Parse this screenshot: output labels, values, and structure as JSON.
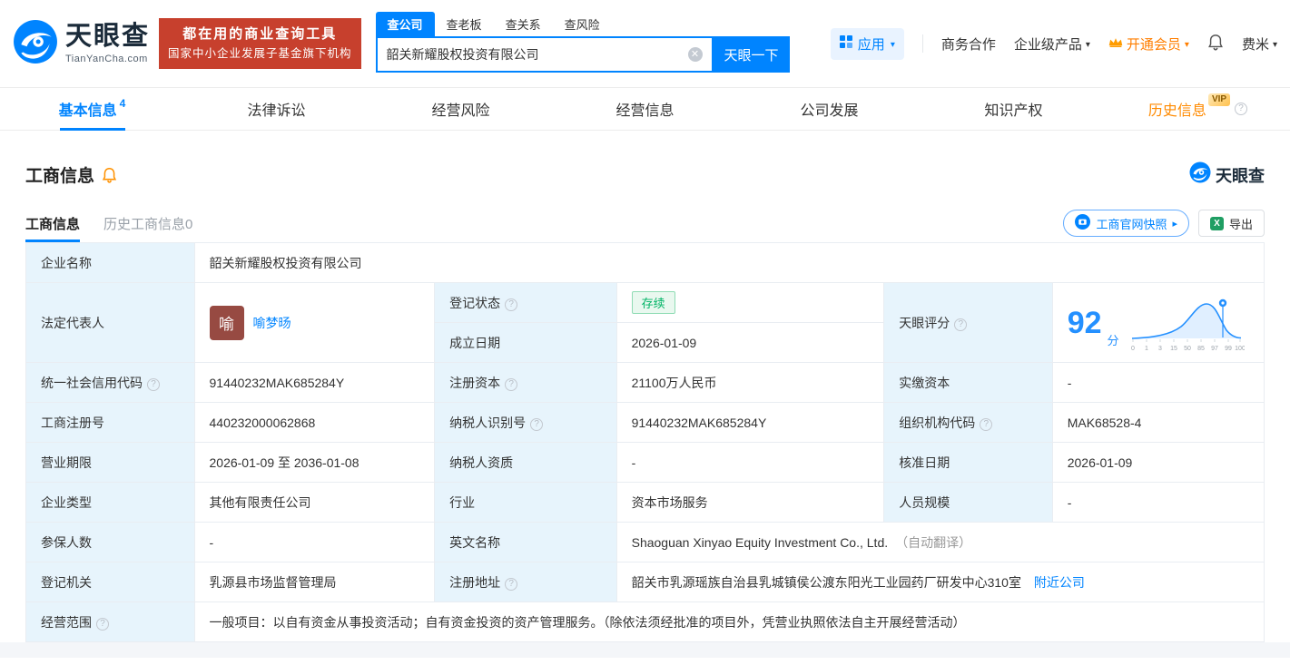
{
  "brand": {
    "name": "天眼查",
    "domain": "TianYanCha.com",
    "slogan_line1": "都在用的商业查询工具",
    "slogan_line2": "国家中小企业发展子基金旗下机构"
  },
  "search": {
    "tabs": [
      {
        "label": "查公司"
      },
      {
        "label": "查老板"
      },
      {
        "label": "查关系"
      },
      {
        "label": "查风险"
      }
    ],
    "value": "韶关新耀股权投资有限公司",
    "button_label": "天眼一下"
  },
  "topnav": {
    "apps": "应用",
    "business_coop": "商务合作",
    "enterprise_products": "企业级产品",
    "vip": "开通会员",
    "username": "费米"
  },
  "tabs": [
    {
      "label": "基本信息",
      "count": "4"
    },
    {
      "label": "法律诉讼"
    },
    {
      "label": "经营风险"
    },
    {
      "label": "经营信息"
    },
    {
      "label": "公司发展"
    },
    {
      "label": "知识产权"
    },
    {
      "label": "历史信息",
      "badge": "VIP"
    }
  ],
  "section": {
    "title": "工商信息",
    "subtabs": [
      {
        "label": "工商信息"
      },
      {
        "label": "历史工商信息0"
      }
    ],
    "snapshot_button": "工商官网快照",
    "export_button": "导出"
  },
  "info": {
    "company_name_label": "企业名称",
    "company_name": "韶关新耀股权投资有限公司",
    "legal_rep_label": "法定代表人",
    "legal_rep_avatar": "喻",
    "legal_rep_name": "喻梦旸",
    "reg_status_label": "登记状态",
    "reg_status": "存续",
    "establish_date_label": "成立日期",
    "establish_date": "2026-01-09",
    "score_label": "天眼评分",
    "credit_code_label": "统一社会信用代码",
    "credit_code": "91440232MAK685284Y",
    "reg_capital_label": "注册资本",
    "reg_capital": "21100万人民币",
    "paid_capital_label": "实缴资本",
    "paid_capital": "-",
    "reg_number_label": "工商注册号",
    "reg_number": "440232000062868",
    "taxpayer_id_label": "纳税人识别号",
    "taxpayer_id": "91440232MAK685284Y",
    "org_code_label": "组织机构代码",
    "org_code": "MAK68528-4",
    "business_term_label": "营业期限",
    "business_term": "2026-01-09 至 2036-01-08",
    "taxpayer_quality_label": "纳税人资质",
    "taxpayer_quality": "-",
    "approval_date_label": "核准日期",
    "approval_date": "2026-01-09",
    "company_type_label": "企业类型",
    "company_type": "其他有限责任公司",
    "industry_label": "行业",
    "industry": "资本市场服务",
    "staff_size_label": "人员规模",
    "staff_size": "-",
    "insured_count_label": "参保人数",
    "insured_count": "-",
    "english_name_label": "英文名称",
    "english_name": "Shaoguan Xinyao Equity Investment Co., Ltd.",
    "english_name_note": "（自动翻译）",
    "reg_authority_label": "登记机关",
    "reg_authority": "乳源县市场监督管理局",
    "address_label": "注册地址",
    "address": "韶关市乳源瑶族自治县乳城镇侯公渡东阳光工业园药厂研发中心310室",
    "nearby_companies_link": "附近公司",
    "business_scope_label": "经营范围",
    "business_scope": "一般项目：以自有资金从事投资活动；自有资金投资的资产管理服务。（除依法须经批准的项目外，凭营业执照依法自主开展经营活动）"
  },
  "score": {
    "value": "92",
    "unit": "分",
    "ticks": [
      "0",
      "1",
      "3",
      "15",
      "50",
      "85",
      "97",
      "99",
      "100"
    ]
  }
}
